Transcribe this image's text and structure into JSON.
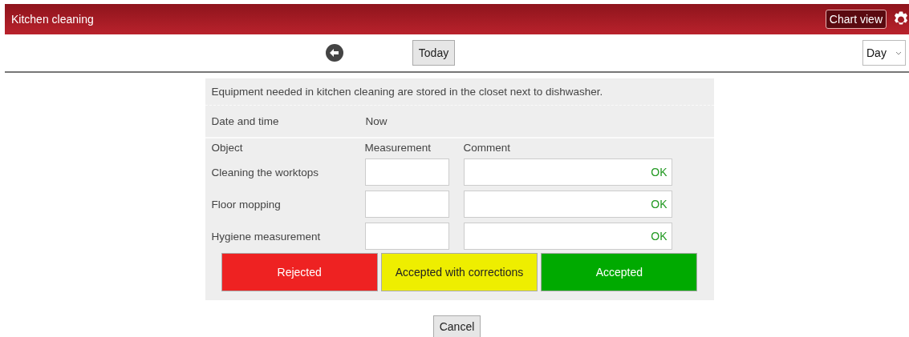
{
  "header": {
    "title": "Kitchen cleaning",
    "chart_button": "Chart view"
  },
  "toolbar": {
    "today_button": "Today",
    "period_select": {
      "value": "Day"
    }
  },
  "form": {
    "info": "Equipment needed in kitchen cleaning are stored in the closet next to dishwasher.",
    "date_label": "Date and time",
    "date_value": "Now",
    "columns": [
      "Object",
      "Measurement",
      "Comment"
    ],
    "rows": [
      {
        "object": "Cleaning the worktops",
        "measurement": "",
        "comment": "OK"
      },
      {
        "object": "Floor mopping",
        "measurement": "",
        "comment": "OK"
      },
      {
        "object": "Hygiene measurement",
        "measurement": "",
        "comment": "OK"
      }
    ],
    "status_buttons": [
      {
        "label": "Rejected",
        "color": "#ee2222"
      },
      {
        "label": "Accepted with corrections",
        "color": "#eeee00"
      },
      {
        "label": "Accepted",
        "color": "#00aa00"
      }
    ]
  },
  "cancel_button": "Cancel"
}
